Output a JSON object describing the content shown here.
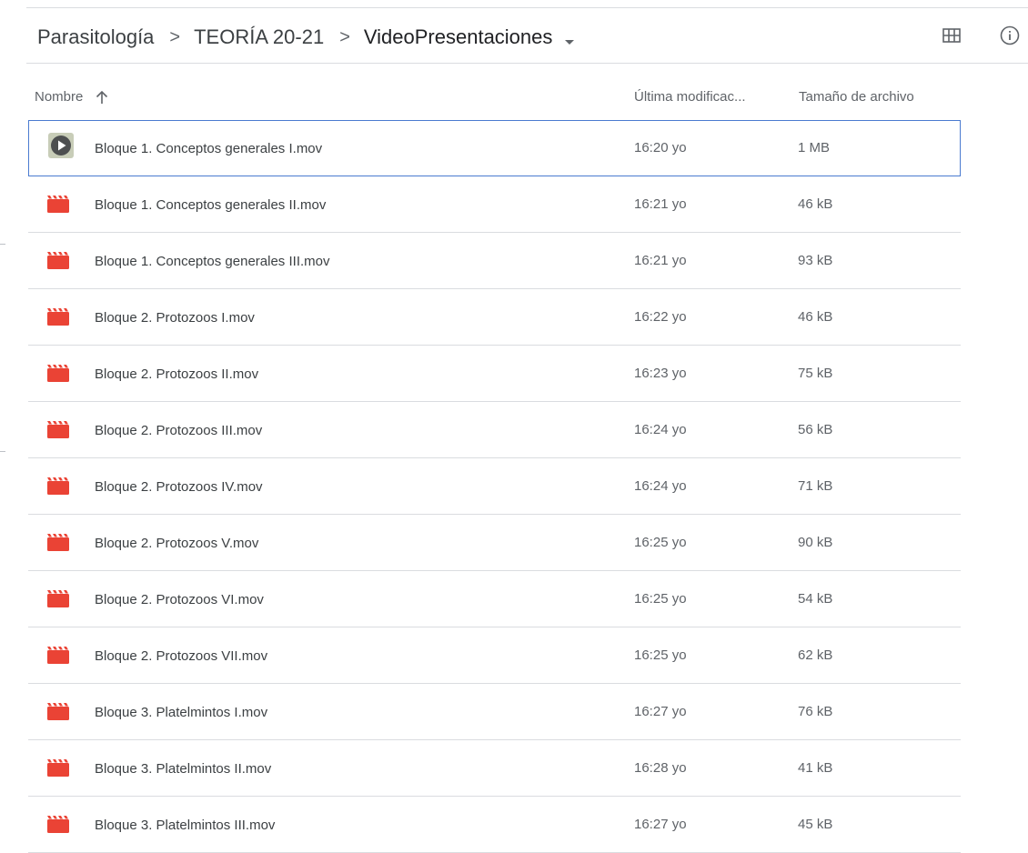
{
  "breadcrumb": [
    {
      "label": "Parasitología"
    },
    {
      "label": "TEORÍA 20-21"
    },
    {
      "label": "VideoPresentaciones"
    }
  ],
  "breadcrumb_separator": ">",
  "toolbar": {
    "grid_icon": "grid-view-icon",
    "info_icon": "info-icon"
  },
  "columns": {
    "name": "Nombre",
    "modified": "Última modificac...",
    "size": "Tamaño de archivo",
    "sort_icon": "arrow-up-icon"
  },
  "colors": {
    "video_icon": "#ea4335",
    "selected_border": "#4a7bd0"
  },
  "files": [
    {
      "name": "Bloque 1. Conceptos generales I.mov",
      "modified": "16:20 yo",
      "size": "1 MB",
      "icon": "video-thumbnail-play-icon",
      "selected": true
    },
    {
      "name": "Bloque 1. Conceptos generales II.mov",
      "modified": "16:21 yo",
      "size": "46 kB",
      "icon": "video-file-icon"
    },
    {
      "name": "Bloque 1. Conceptos generales III.mov",
      "modified": "16:21 yo",
      "size": "93 kB",
      "icon": "video-file-icon"
    },
    {
      "name": "Bloque 2. Protozoos I.mov",
      "modified": "16:22 yo",
      "size": "46 kB",
      "icon": "video-file-icon"
    },
    {
      "name": "Bloque 2. Protozoos II.mov",
      "modified": "16:23 yo",
      "size": "75 kB",
      "icon": "video-file-icon"
    },
    {
      "name": "Bloque 2. Protozoos III.mov",
      "modified": "16:24 yo",
      "size": "56 kB",
      "icon": "video-file-icon"
    },
    {
      "name": "Bloque 2. Protozoos IV.mov",
      "modified": "16:24 yo",
      "size": "71 kB",
      "icon": "video-file-icon"
    },
    {
      "name": "Bloque 2. Protozoos V.mov",
      "modified": "16:25 yo",
      "size": "90 kB",
      "icon": "video-file-icon"
    },
    {
      "name": "Bloque 2. Protozoos VI.mov",
      "modified": "16:25 yo",
      "size": "54 kB",
      "icon": "video-file-icon"
    },
    {
      "name": "Bloque 2. Protozoos VII.mov",
      "modified": "16:25 yo",
      "size": "62 kB",
      "icon": "video-file-icon"
    },
    {
      "name": "Bloque 3. Platelmintos I.mov",
      "modified": "16:27 yo",
      "size": "76 kB",
      "icon": "video-file-icon"
    },
    {
      "name": "Bloque 3. Platelmintos II.mov",
      "modified": "16:28 yo",
      "size": "41 kB",
      "icon": "video-file-icon"
    },
    {
      "name": "Bloque 3. Platelmintos III.mov",
      "modified": "16:27 yo",
      "size": "45 kB",
      "icon": "video-file-icon"
    }
  ]
}
